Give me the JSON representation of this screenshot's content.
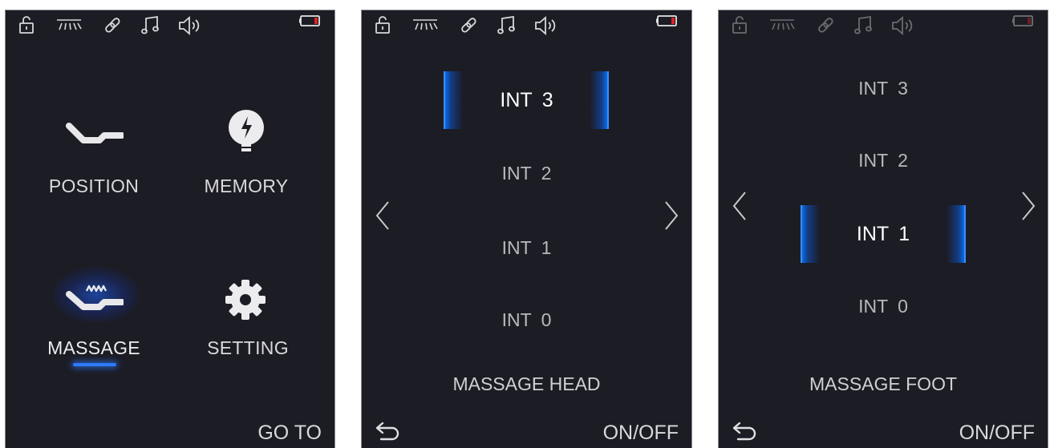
{
  "status_icons": [
    "lock-icon",
    "light-icon",
    "link-icon",
    "music-icon",
    "speaker-icon",
    "battery-icon"
  ],
  "colors": {
    "background": "#1c1c25",
    "accent": "#2f7bff",
    "battery_low": "#e02020"
  },
  "home": {
    "items": [
      {
        "label": "POSITION",
        "icon": "position-icon"
      },
      {
        "label": "MEMORY",
        "icon": "memory-icon"
      },
      {
        "label": "MASSAGE",
        "icon": "massage-icon",
        "selected": true
      },
      {
        "label": "SETTING",
        "icon": "setting-icon"
      }
    ],
    "goto_label": "GO TO"
  },
  "head": {
    "levels": [
      {
        "name": "INT",
        "value": "3",
        "selected": true
      },
      {
        "name": "INT",
        "value": "2"
      },
      {
        "name": "INT",
        "value": "1"
      },
      {
        "name": "INT",
        "value": "0"
      }
    ],
    "title": "MASSAGE HEAD",
    "onoff_label": "ON/OFF"
  },
  "foot": {
    "levels": [
      {
        "name": "INT",
        "value": "3"
      },
      {
        "name": "INT",
        "value": "2"
      },
      {
        "name": "INT",
        "value": "1",
        "selected": true
      },
      {
        "name": "INT",
        "value": "0"
      }
    ],
    "title": "MASSAGE FOOT",
    "onoff_label": "ON/OFF"
  }
}
